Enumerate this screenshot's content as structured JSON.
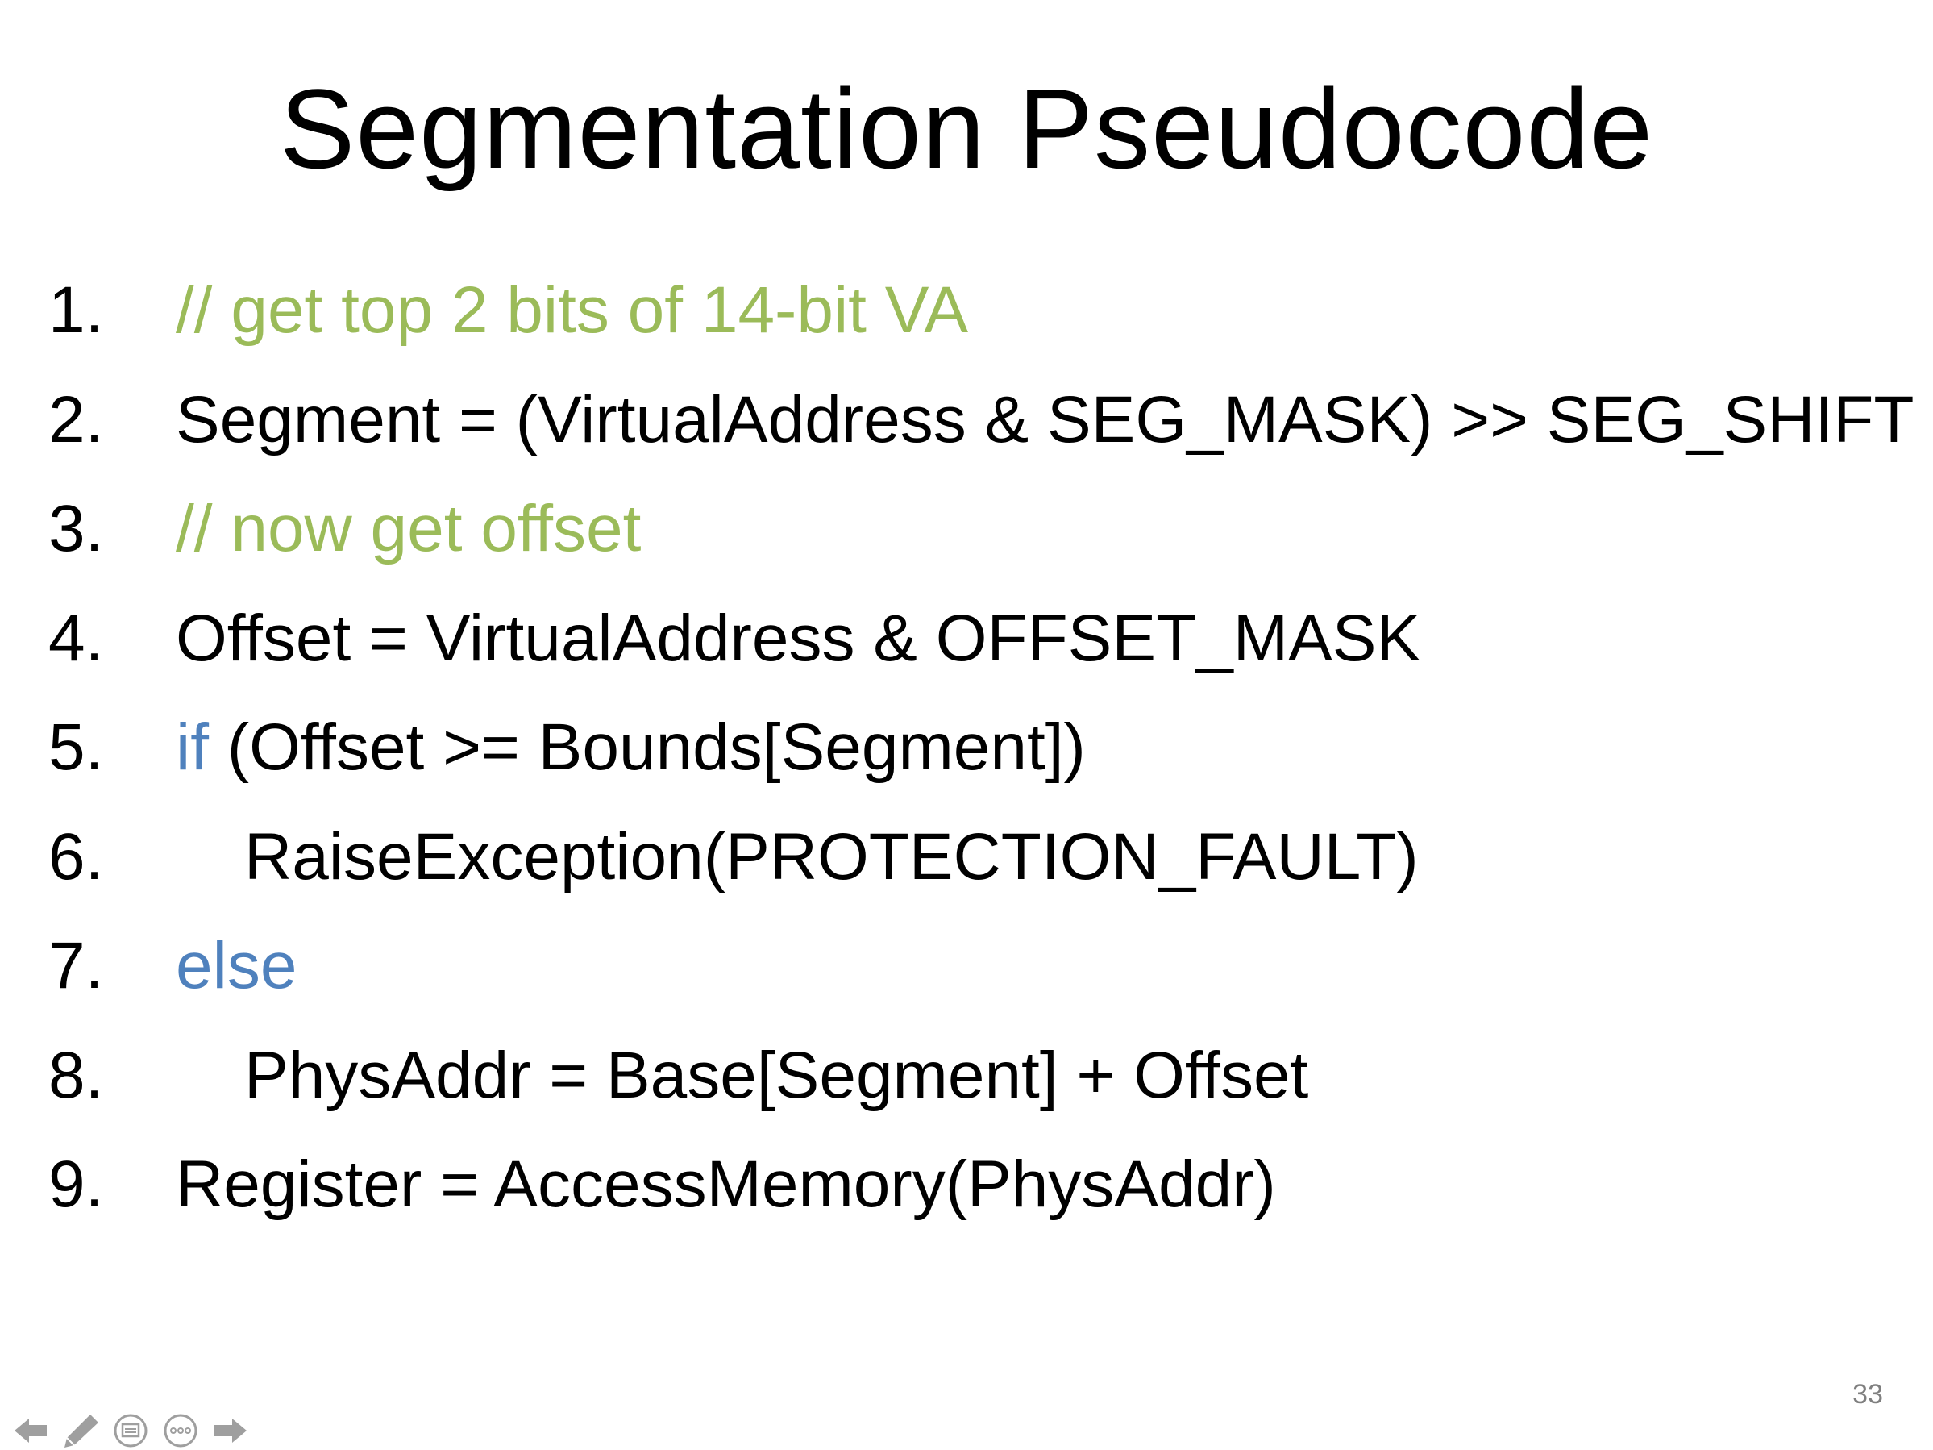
{
  "slide": {
    "title": "Segmentation Pseudocode",
    "page_number": "33",
    "lines": [
      {
        "num": "1.",
        "parts": [
          {
            "text": "// get top 2 bits of 14-bit VA",
            "style": "comment"
          }
        ]
      },
      {
        "num": "2.",
        "parts": [
          {
            "text": "Segment = (VirtualAddress & SEG_MASK) >> SEG_SHIFT",
            "style": "plain"
          }
        ]
      },
      {
        "num": "3.",
        "parts": [
          {
            "text": "// now get offset",
            "style": "comment"
          }
        ]
      },
      {
        "num": "4.",
        "parts": [
          {
            "text": "Offset = VirtualAddress & OFFSET_MASK",
            "style": "plain"
          }
        ]
      },
      {
        "num": "5.",
        "parts": [
          {
            "text": "if",
            "style": "keyword"
          },
          {
            "text": " (Offset >= Bounds[Segment])",
            "style": "plain"
          }
        ]
      },
      {
        "num": "6.",
        "indent": true,
        "parts": [
          {
            "text": "RaiseException(PROTECTION_FAULT)",
            "style": "plain"
          }
        ]
      },
      {
        "num": "7.",
        "parts": [
          {
            "text": "else",
            "style": "keyword"
          }
        ]
      },
      {
        "num": "8.",
        "indent": true,
        "parts": [
          {
            "text": "PhysAddr = Base[Segment] + Offset",
            "style": "plain"
          }
        ]
      },
      {
        "num": "9.",
        "parts": [
          {
            "text": "Register = AccessMemory(PhysAddr)",
            "style": "plain"
          }
        ]
      }
    ]
  },
  "colors": {
    "comment": "#9bbb59",
    "keyword": "#4f81bd",
    "text": "#000000"
  },
  "nav_controls": [
    {
      "name": "previous-slide-icon"
    },
    {
      "name": "pen-icon"
    },
    {
      "name": "slides-view-icon"
    },
    {
      "name": "more-options-icon"
    },
    {
      "name": "next-slide-icon"
    }
  ]
}
